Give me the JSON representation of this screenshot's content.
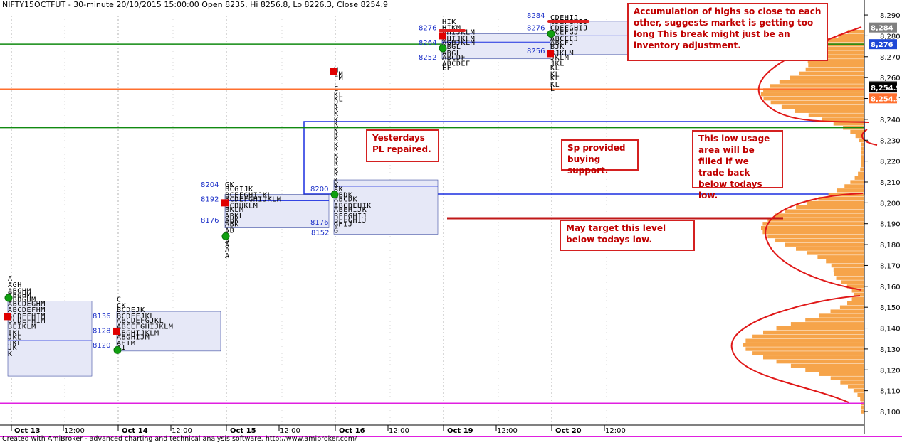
{
  "header": {
    "title": "NIFTY15OCTFUT - 30-minute 20/10/2015 15:00:00 Open 8235, Hi 8256.8, Lo 8226.3, Close 8254.9"
  },
  "footer": {
    "credit": "Created with AmiBroker - advanced charting and technical analysis software. http://www.amibroker.com/"
  },
  "chart_data": {
    "type": "market-profile",
    "ylim": [
      8095,
      8295
    ],
    "y_ticks": [
      8100,
      8110,
      8120,
      8130,
      8140,
      8150,
      8160,
      8170,
      8180,
      8190,
      8200,
      8210,
      8220,
      8230,
      8240,
      8250,
      8260,
      8270,
      8280,
      8290
    ],
    "x_ticks": [
      "Oct 13",
      "12:00",
      "Oct 14",
      "12:00",
      "Oct 15",
      "12:00",
      "Oct 16",
      "12:00",
      "Oct 19",
      "12:00",
      "Oct 20",
      "12:00"
    ],
    "price_tags": [
      {
        "label": "8,284",
        "value": 8284,
        "bg": "#808080",
        "fg": "#ffffff"
      },
      {
        "label": "8,276",
        "value": 8276,
        "bg": "#1f48d6",
        "fg": "#ffffff"
      },
      {
        "label": "8,256",
        "value": 8256,
        "bg": "#808080",
        "fg": "#ffffff"
      },
      {
        "label": "8,254.9",
        "value": 8254.9,
        "bg": "#000000",
        "fg": "#ffffff"
      },
      {
        "label": "8,254.5",
        "value": 8254.5,
        "bg": "#ff6f2e",
        "fg": "#ffffff"
      }
    ],
    "horizontal_lines": [
      {
        "value": 8276,
        "color": "#118a11"
      },
      {
        "value": 8254.5,
        "color": "#ff6f2e"
      },
      {
        "value": 8236,
        "color": "#118a11"
      },
      {
        "value": 8104,
        "color": "#e020e0"
      }
    ],
    "sessions": [
      {
        "date": "Oct 13",
        "rows": [
          [
            "A",
            8164
          ],
          [
            "AGH",
            8161
          ],
          [
            "ABGHM",
            8158
          ],
          [
            "ABGHM",
            8156
          ],
          [
            "ABDGHM",
            8154
          ],
          [
            "ABCDEGHM",
            8152
          ],
          [
            "ABCDEFHM",
            8149
          ],
          [
            "BCDEFHIM",
            8146
          ],
          [
            "BCDEFHIM",
            8144
          ],
          [
            "BEIKLM",
            8141
          ],
          [
            "IKL",
            8138
          ],
          [
            "JKL",
            8136
          ],
          [
            "JKL",
            8133
          ],
          [
            "JK",
            8131
          ],
          [
            "K",
            8128
          ]
        ],
        "value_area": [
          8117,
          8153
        ],
        "poc": 8134,
        "labels": [
          [
            "8136",
            8146
          ],
          [
            "8128",
            8139
          ],
          [
            "8120",
            8132
          ]
        ],
        "markers": [
          [
            "green",
            8154.5
          ],
          [
            "red",
            8145.5
          ]
        ]
      },
      {
        "date": "Oct 14",
        "rows": [
          [
            "C",
            8154
          ],
          [
            "CK",
            8151
          ],
          [
            "BCDEJK",
            8149
          ],
          [
            "BCDEFJKL",
            8146
          ],
          [
            "ABCDEFGJKL",
            8144
          ],
          [
            "ABCEFGHIJKLM",
            8141
          ],
          [
            "ABGHIJKLM",
            8138
          ],
          [
            "ABGHIJM",
            8136
          ],
          [
            "AHIM",
            8133
          ],
          [
            "AI",
            8131
          ]
        ],
        "value_area": [
          8129,
          8148
        ],
        "poc": 8140,
        "markers": [
          [
            "red",
            8138.5
          ],
          [
            "green",
            8129.5
          ]
        ]
      },
      {
        "date": "Oct 15",
        "rows": [
          [
            "GK",
            8209
          ],
          [
            "BCGIJK",
            8207
          ],
          [
            "BCEFGHIJKL",
            8204
          ],
          [
            "BCDEFGHIJKLM",
            8202
          ],
          [
            "BCDHKLM",
            8199
          ],
          [
            "BKLM",
            8197
          ],
          [
            "ABKL",
            8194
          ],
          [
            "ABK",
            8192
          ],
          [
            "ABK",
            8190
          ],
          [
            "AB",
            8187
          ],
          [
            "A",
            8185
          ],
          [
            "A",
            8182
          ],
          [
            "A",
            8180
          ],
          [
            "A",
            8178
          ],
          [
            "A",
            8175
          ]
        ],
        "value_area": [
          8188,
          8204
        ],
        "poc": 8201,
        "labels": [
          [
            "8204",
            8209
          ],
          [
            "8200",
            8207
          ],
          [
            "8192",
            8202
          ],
          [
            "8176",
            8192
          ],
          [
            "8176",
            8191
          ]
        ],
        "markers": [
          [
            "red",
            8200
          ],
          [
            "green",
            8184
          ]
        ]
      },
      {
        "date": "Oct 16",
        "rows": [
          [
            "M",
            8264
          ],
          [
            "LM",
            8262
          ],
          [
            "LM",
            8260
          ],
          [
            "L",
            8257
          ],
          [
            "L",
            8255
          ],
          [
            "KL",
            8252
          ],
          [
            "KL",
            8250
          ],
          [
            "K",
            8247
          ],
          [
            "K",
            8245
          ],
          [
            "K",
            8243
          ],
          [
            "K",
            8240
          ],
          [
            "K",
            8238
          ],
          [
            "K",
            8235
          ],
          [
            "K",
            8233
          ],
          [
            "K",
            8231
          ],
          [
            "K",
            8228
          ],
          [
            "K",
            8226
          ],
          [
            "K",
            8223
          ],
          [
            "K",
            8221
          ],
          [
            "K",
            8219
          ],
          [
            "K",
            8216
          ],
          [
            "K",
            8214
          ],
          [
            "K",
            8211
          ],
          [
            "K",
            8209
          ],
          [
            "AK",
            8207
          ],
          [
            "ABDK",
            8204
          ],
          [
            "ABCDK",
            8202
          ],
          [
            "ABCDEHIK",
            8199
          ],
          [
            "ABEHIJK",
            8197
          ],
          [
            "BEFGHIJ",
            8194
          ],
          [
            "BEFGHIJ",
            8192
          ],
          [
            "GHIJ",
            8190
          ],
          [
            "G",
            8187
          ]
        ],
        "value_area": [
          8185,
          8211
        ],
        "poc": 8208,
        "labels": [
          [
            "8152",
            8186
          ]
        ],
        "markers": [
          [
            "red",
            8263
          ],
          [
            "green",
            8204
          ]
        ]
      },
      {
        "date": "Oct 19",
        "rows": [
          [
            "HIK",
            8287
          ],
          [
            "HIKM",
            8284
          ],
          [
            "AHIJKLM",
            8282
          ],
          [
            "AHIJKLM",
            8279
          ],
          [
            "AGHJKLM",
            8277
          ],
          [
            "ABGL",
            8275
          ],
          [
            "ABGL",
            8272
          ],
          [
            "ABCDF",
            8270
          ],
          [
            "ABCDEF",
            8267
          ],
          [
            "EF",
            8265
          ]
        ],
        "value_area": [
          8269,
          8281
        ],
        "poc": 8277,
        "labels": [
          [
            "8276",
            8284
          ],
          [
            "8264",
            8277
          ],
          [
            "8252",
            8270
          ]
        ],
        "markers": [
          [
            "red",
            8280
          ],
          [
            "green",
            8274
          ]
        ]
      },
      {
        "date": "Oct 20",
        "rows": [
          [
            "CDEHIJ",
            8289
          ],
          [
            "CDEFGHIJ",
            8287
          ],
          [
            "CDEFGHIJ",
            8284
          ],
          [
            "ACEFGJ",
            8282
          ],
          [
            "ABCEFJ",
            8279
          ],
          [
            "ABCFJ",
            8277
          ],
          [
            "BJK",
            8275
          ],
          [
            "BJKLM",
            8272
          ],
          [
            "JKLM",
            8270
          ],
          [
            "JKL",
            8267
          ],
          [
            "KL",
            8265
          ],
          [
            "KL",
            8262
          ],
          [
            "KL",
            8260
          ],
          [
            "KL",
            8257
          ],
          [
            "L",
            8255
          ]
        ],
        "value_area": [
          8271,
          8287
        ],
        "poc": 8280,
        "labels": [
          [
            "8284",
            8290
          ],
          [
            "8276",
            8284
          ],
          [
            "8256",
            8273
          ]
        ],
        "markers": [
          [
            "green",
            8281
          ],
          [
            "red",
            8271.5
          ]
        ]
      }
    ]
  },
  "annotations": {
    "accumulation": "Accumulation of highs so close to each other, suggests market is getting too long This break might just be an inventory adjustment.",
    "yesterday_pl": "Yesterdays PL repaired.",
    "sp_support": "Sp provided buying support.",
    "low_usage": "This low usage area will be filled if we trade back below todays low.",
    "target_level": "May target this level below todays low."
  }
}
